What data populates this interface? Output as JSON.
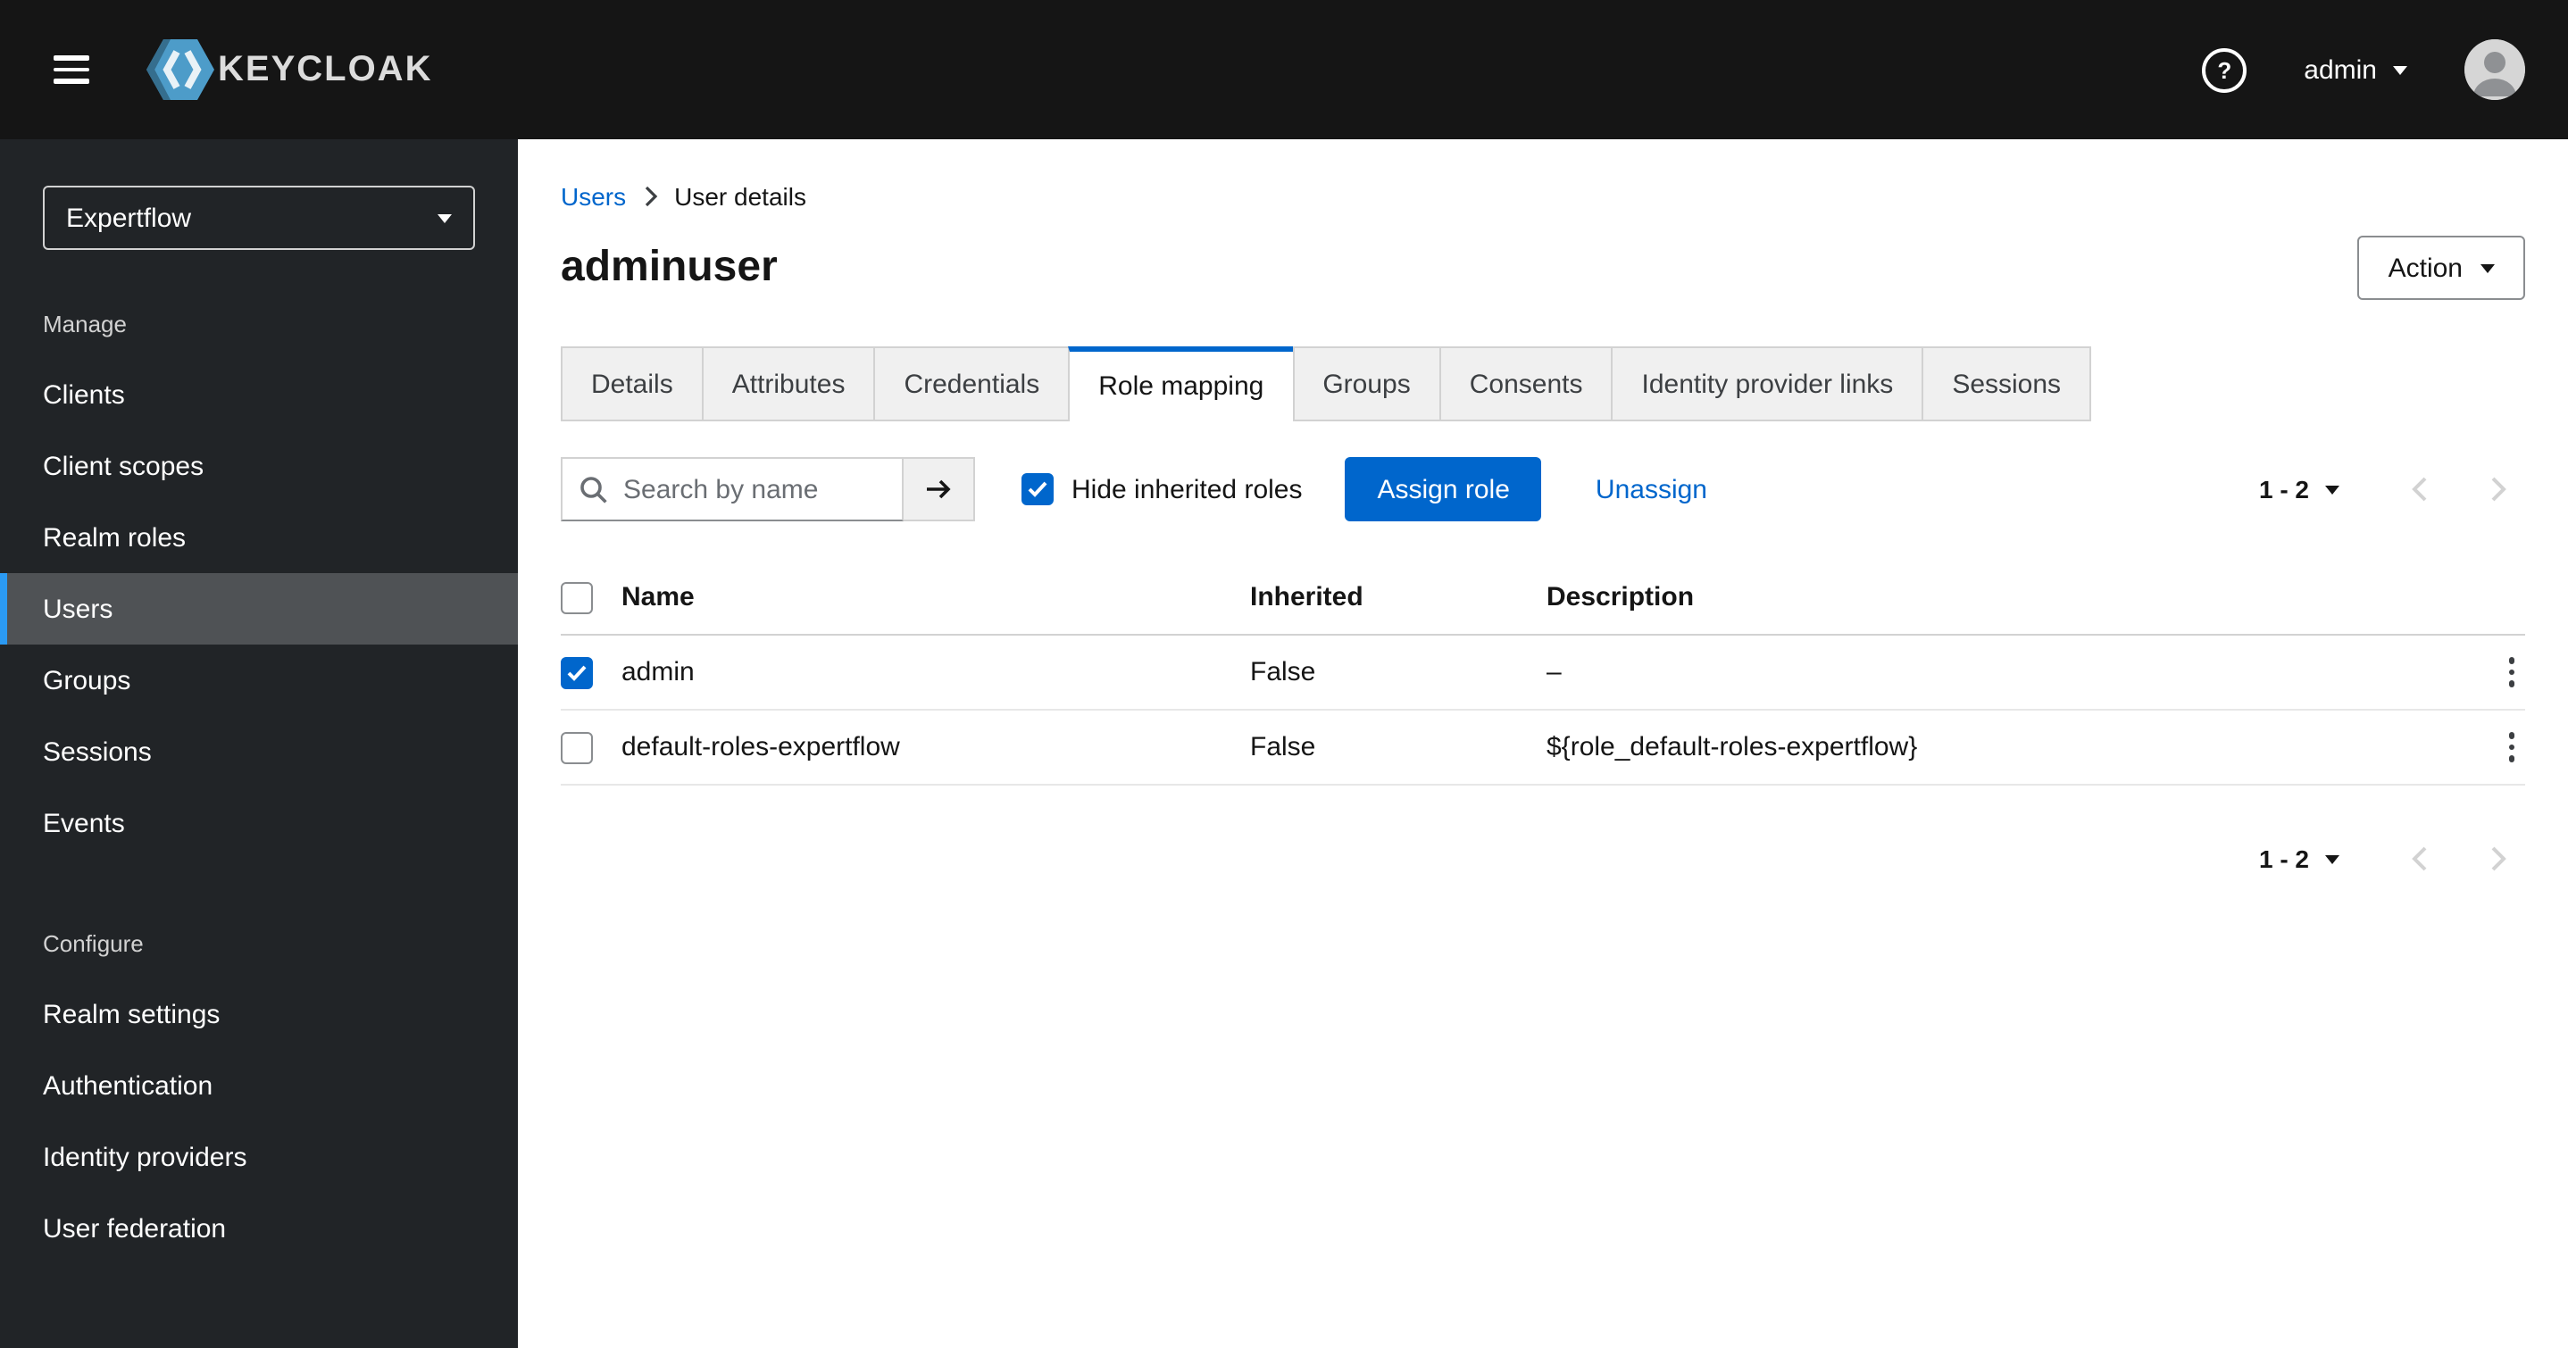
{
  "colors": {
    "accent": "#0066cc",
    "masthead_bg": "#151515",
    "sidebar_bg": "#212427",
    "active_nav_bg": "#4f5255",
    "active_nav_indicator": "#2b9af3",
    "link": "#0066cc"
  },
  "header": {
    "brand": "KEYCLOAK",
    "help_icon": "question-circle-icon",
    "help_glyph": "?",
    "user": "admin"
  },
  "sidebar": {
    "realm": "Expertflow",
    "sections": [
      {
        "label": "Manage",
        "items": [
          {
            "label": "Clients",
            "active": false
          },
          {
            "label": "Client scopes",
            "active": false
          },
          {
            "label": "Realm roles",
            "active": false
          },
          {
            "label": "Users",
            "active": true
          },
          {
            "label": "Groups",
            "active": false
          },
          {
            "label": "Sessions",
            "active": false
          },
          {
            "label": "Events",
            "active": false
          }
        ]
      },
      {
        "label": "Configure",
        "items": [
          {
            "label": "Realm settings",
            "active": false
          },
          {
            "label": "Authentication",
            "active": false
          },
          {
            "label": "Identity providers",
            "active": false
          },
          {
            "label": "User federation",
            "active": false
          }
        ]
      }
    ]
  },
  "main": {
    "breadcrumb": [
      {
        "label": "Users",
        "link": true
      },
      {
        "label": "User details",
        "link": false
      }
    ],
    "title": "adminuser",
    "action_button": "Action",
    "tabs": [
      {
        "label": "Details",
        "active": false
      },
      {
        "label": "Attributes",
        "active": false
      },
      {
        "label": "Credentials",
        "active": false
      },
      {
        "label": "Role mapping",
        "active": true
      },
      {
        "label": "Groups",
        "active": false
      },
      {
        "label": "Consents",
        "active": false
      },
      {
        "label": "Identity provider links",
        "active": false
      },
      {
        "label": "Sessions",
        "active": false
      }
    ],
    "toolbar": {
      "search_placeholder": "Search by name",
      "search_value": "",
      "hide_inherited": {
        "label": "Hide inherited roles",
        "checked": true
      },
      "assign_button": "Assign role",
      "unassign_link": "Unassign",
      "pagination": {
        "range": "1 - 2"
      }
    },
    "table": {
      "columns": [
        "Name",
        "Inherited",
        "Description"
      ],
      "rows": [
        {
          "checked": true,
          "name": "admin",
          "inherited": "False",
          "description": "–"
        },
        {
          "checked": false,
          "name": "default-roles-expertflow",
          "inherited": "False",
          "description": "${role_default-roles-expertflow}"
        }
      ]
    },
    "bottom_pagination": {
      "range": "1 - 2"
    }
  }
}
